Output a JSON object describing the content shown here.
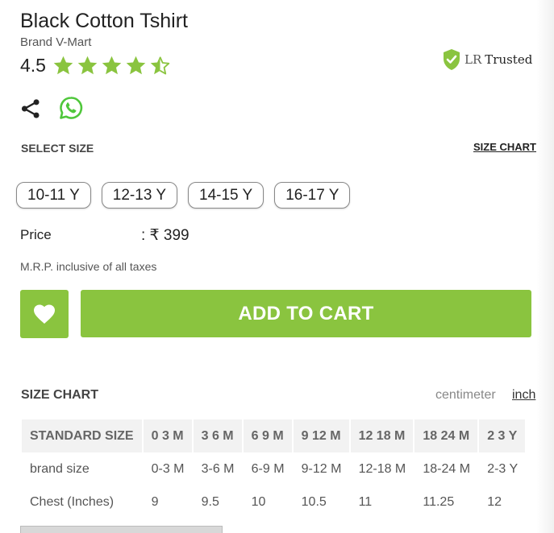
{
  "product": {
    "title": "Black Cotton Tshirt",
    "brand": "Brand V-Mart",
    "rating": "4.5",
    "rating_stars": 4.5,
    "star_color": "#8ac43f"
  },
  "trusted": {
    "prefix": "LR",
    "label": "Trusted",
    "badge_color": "#8ac43f"
  },
  "icons": {
    "share": "share-icon",
    "whatsapp": "whatsapp-icon",
    "heart": "heart-icon",
    "badge": "shield-check-icon"
  },
  "size_select": {
    "heading": "SELECT SIZE",
    "chart_link": "SIZE CHART",
    "options": [
      "10-11 Y",
      "12-13 Y",
      "14-15 Y",
      "16-17 Y"
    ]
  },
  "price": {
    "label": "Price",
    "value": ": ₹ 399",
    "mrp_note": "M.R.P. inclusive of all taxes"
  },
  "actions": {
    "add_to_cart": "ADD TO CART",
    "accent": "#8ac43f"
  },
  "size_chart": {
    "heading": "SIZE CHART",
    "units": {
      "centimeter": "centimeter",
      "inch": "inch",
      "selected": "inch"
    },
    "headers": [
      "STANDARD SIZE",
      "0 3 M",
      "3 6 M",
      "6 9 M",
      "9 12 M",
      "12 18 M",
      "18 24 M",
      "2 3 Y"
    ],
    "rows": [
      [
        "brand size",
        "0-3 M",
        "3-6 M",
        "6-9 M",
        "9-12 M",
        "12-18 M",
        "18-24 M",
        "2-3 Y"
      ],
      [
        "Chest (Inches)",
        "9",
        "9.5",
        "10",
        "10.5",
        "11",
        "11.25",
        "12"
      ]
    ]
  }
}
